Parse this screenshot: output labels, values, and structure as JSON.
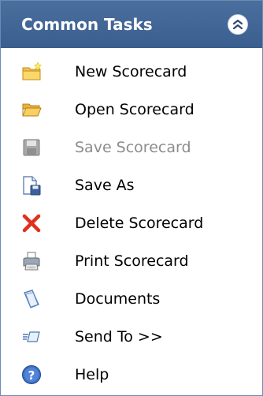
{
  "panel": {
    "title": "Common Tasks",
    "collapse_icon": "double-chevron-up-icon"
  },
  "colors": {
    "header_bg": "#3f6596",
    "header_text": "#ffffff",
    "disabled_text": "#8c8c8c"
  },
  "tasks": [
    {
      "label": "New Scorecard",
      "icon": "new-folder-icon",
      "enabled": true
    },
    {
      "label": "Open Scorecard",
      "icon": "open-folder-icon",
      "enabled": true
    },
    {
      "label": "Save Scorecard",
      "icon": "save-disk-icon",
      "enabled": false
    },
    {
      "label": "Save As",
      "icon": "save-as-icon",
      "enabled": true
    },
    {
      "label": "Delete Scorecard",
      "icon": "delete-x-icon",
      "enabled": true
    },
    {
      "label": "Print Scorecard",
      "icon": "printer-icon",
      "enabled": true
    },
    {
      "label": "Documents",
      "icon": "documents-icon",
      "enabled": true
    },
    {
      "label": "Send To >>",
      "icon": "send-to-icon",
      "enabled": true
    },
    {
      "label": "Help",
      "icon": "help-icon",
      "enabled": true
    }
  ]
}
